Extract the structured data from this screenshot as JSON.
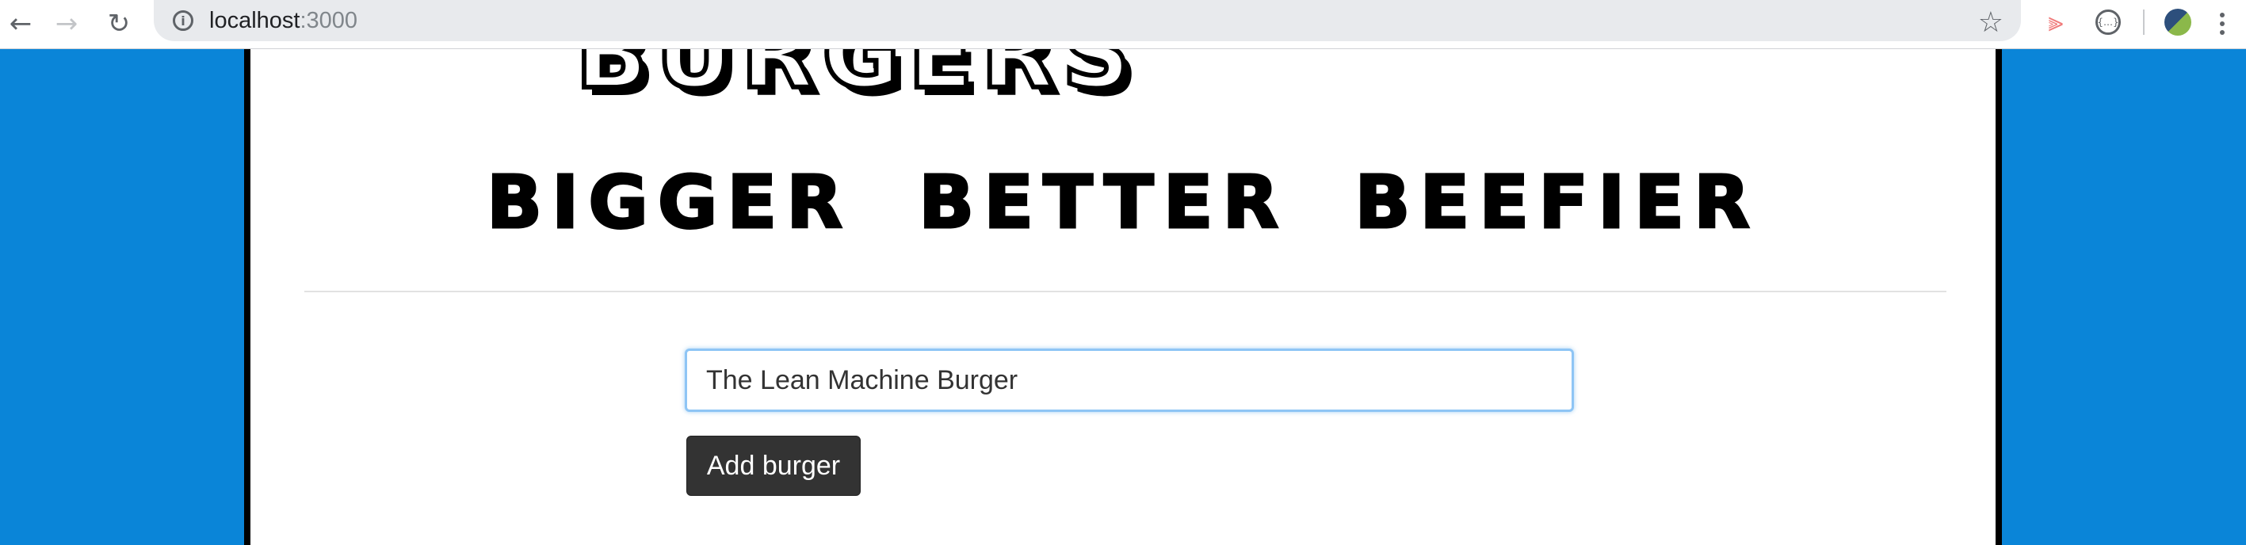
{
  "browser": {
    "url_host": "localhost",
    "url_port": ":3000",
    "back_glyph": "←",
    "forward_glyph": "→",
    "reload_glyph": "↻",
    "star_glyph": "☆",
    "ext_glyph": "⫸",
    "ext2_glyph": "{…}",
    "info_glyph": "i"
  },
  "header": {
    "title": "BURGERS",
    "tagline": "BIGGER BETTER BEEFIER"
  },
  "form": {
    "input_value": "The Lean Machine Burger",
    "submit_label": "Add burger"
  }
}
